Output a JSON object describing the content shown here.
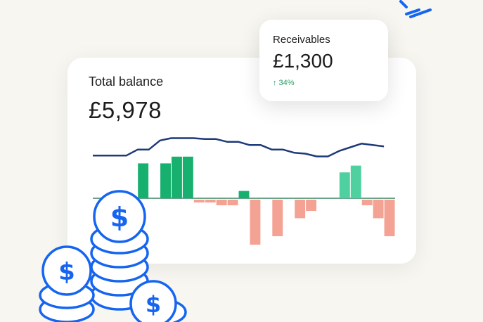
{
  "total_balance": {
    "label": "Total balance",
    "value": "£5,978"
  },
  "receivables": {
    "label": "Receivables",
    "value": "£1,300",
    "change_icon": "arrow-up-icon",
    "change_text": "34%"
  },
  "colors": {
    "line": "#1f3a7a",
    "positive": "#18b06f",
    "negative": "#f4a293",
    "baseline": "#6aa38a",
    "coin": "#1565f0"
  },
  "chart_data": {
    "type": "bar",
    "balance_line": [
      0.68,
      0.68,
      0.68,
      0.68,
      0.55,
      0.55,
      0.35,
      0.3,
      0.3,
      0.3,
      0.32,
      0.32,
      0.38,
      0.38,
      0.45,
      0.45,
      0.55,
      0.55,
      0.62,
      0.64,
      0.7,
      0.7,
      0.58,
      0.5,
      0.42,
      0.45,
      0.48
    ],
    "cashflow": [
      0,
      0,
      0,
      0,
      0.62,
      0,
      0.62,
      0.74,
      0.74,
      -0.05,
      -0.05,
      -0.1,
      -0.1,
      0.13,
      -0.8,
      0,
      -0.65,
      0,
      -0.33,
      -0.2,
      0,
      0,
      0.46,
      0.58,
      -0.1,
      -0.33,
      -0.65
    ]
  }
}
